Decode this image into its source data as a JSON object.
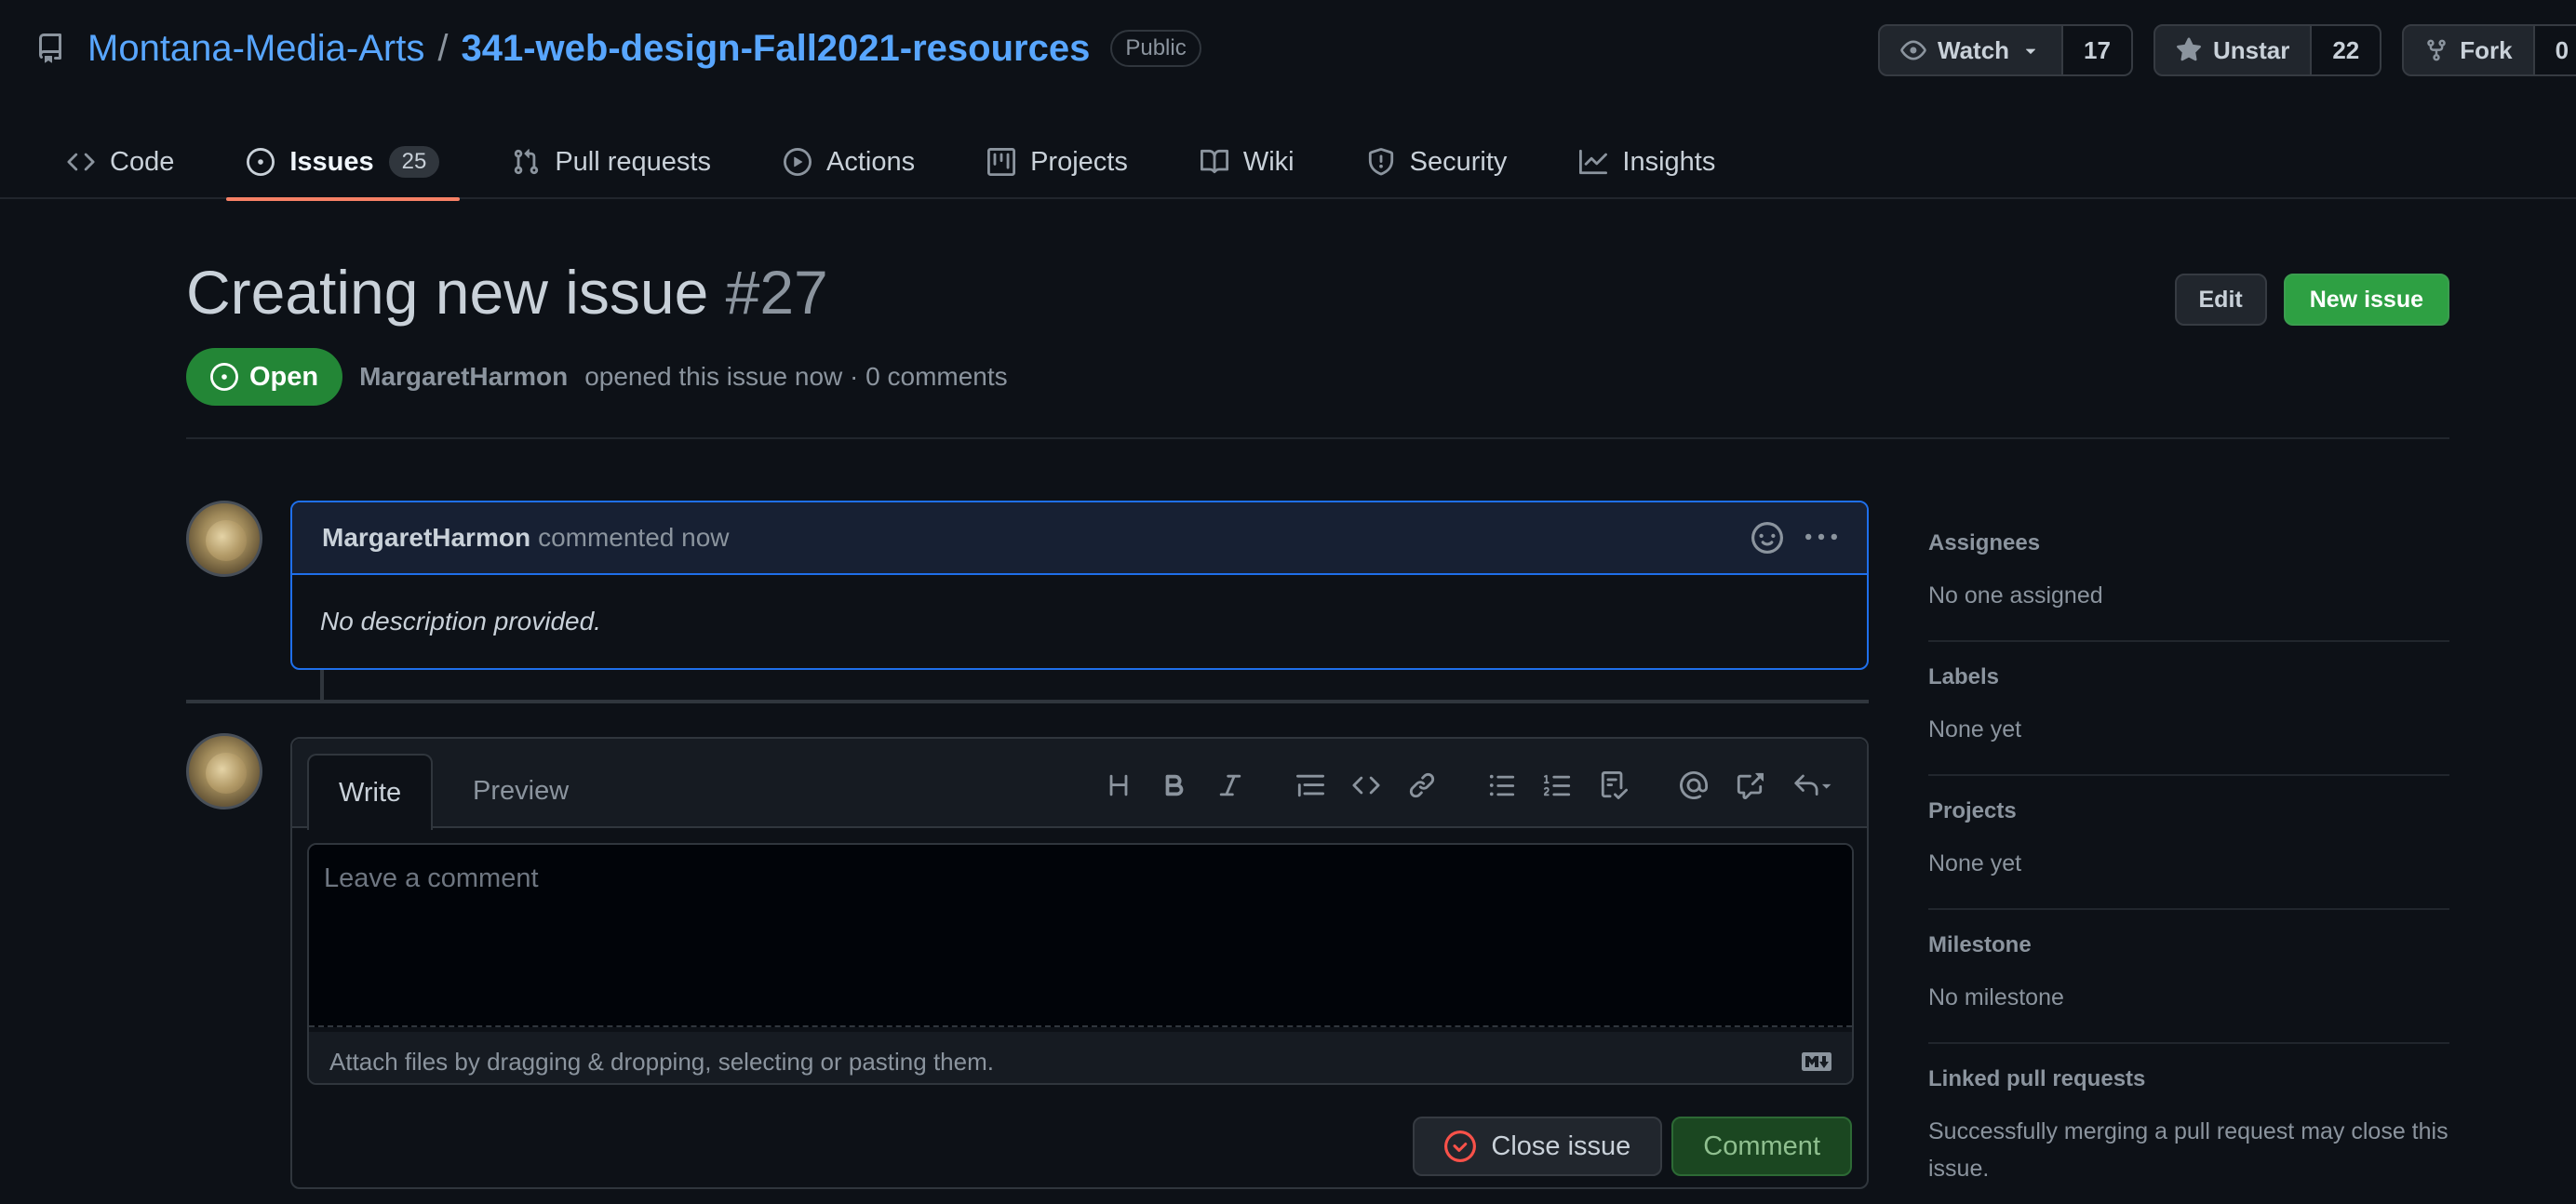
{
  "repo": {
    "owner": "Montana-Media-Arts",
    "separator": "/",
    "name": "341-web-design-Fall2021-resources",
    "visibility": "Public",
    "watch_label": "Watch",
    "watch_count": "17",
    "star_label": "Unstar",
    "star_count": "22",
    "fork_label": "Fork",
    "fork_count": "0"
  },
  "nav": {
    "tabs": [
      {
        "label": "Code",
        "icon": "code-icon"
      },
      {
        "label": "Issues",
        "icon": "issue-opened-icon",
        "counter": "25",
        "active": true
      },
      {
        "label": "Pull requests",
        "icon": "pull-request-icon"
      },
      {
        "label": "Actions",
        "icon": "play-icon"
      },
      {
        "label": "Projects",
        "icon": "project-icon"
      },
      {
        "label": "Wiki",
        "icon": "book-icon"
      },
      {
        "label": "Security",
        "icon": "shield-icon"
      },
      {
        "label": "Insights",
        "icon": "graph-icon"
      }
    ]
  },
  "issue": {
    "title": "Creating new issue",
    "number": "#27",
    "edit_label": "Edit",
    "new_issue_label": "New issue",
    "state": "Open",
    "author": "MargaretHarmon",
    "meta_text": "opened this issue now · 0 comments"
  },
  "comment": {
    "author": "MargaretHarmon",
    "action": "commented now",
    "body": "No description provided."
  },
  "form": {
    "tab_write": "Write",
    "tab_preview": "Preview",
    "placeholder": "Leave a comment",
    "attach_text": "Attach files by dragging & dropping, selecting or pasting them.",
    "close_label": "Close issue",
    "comment_label": "Comment"
  },
  "sidebar": {
    "assignees_title": "Assignees",
    "assignees_value": "No one assigned",
    "labels_title": "Labels",
    "labels_value": "None yet",
    "projects_title": "Projects",
    "projects_value": "None yet",
    "milestone_title": "Milestone",
    "milestone_value": "No milestone",
    "linked_title": "Linked pull requests",
    "linked_value": "Successfully merging a pull request may close this issue."
  },
  "colors": {
    "background": "#0d1117",
    "link": "#58a6ff",
    "open_green": "#238636",
    "active_tab_underline": "#f78166",
    "focus_blue": "#1f6feb"
  }
}
